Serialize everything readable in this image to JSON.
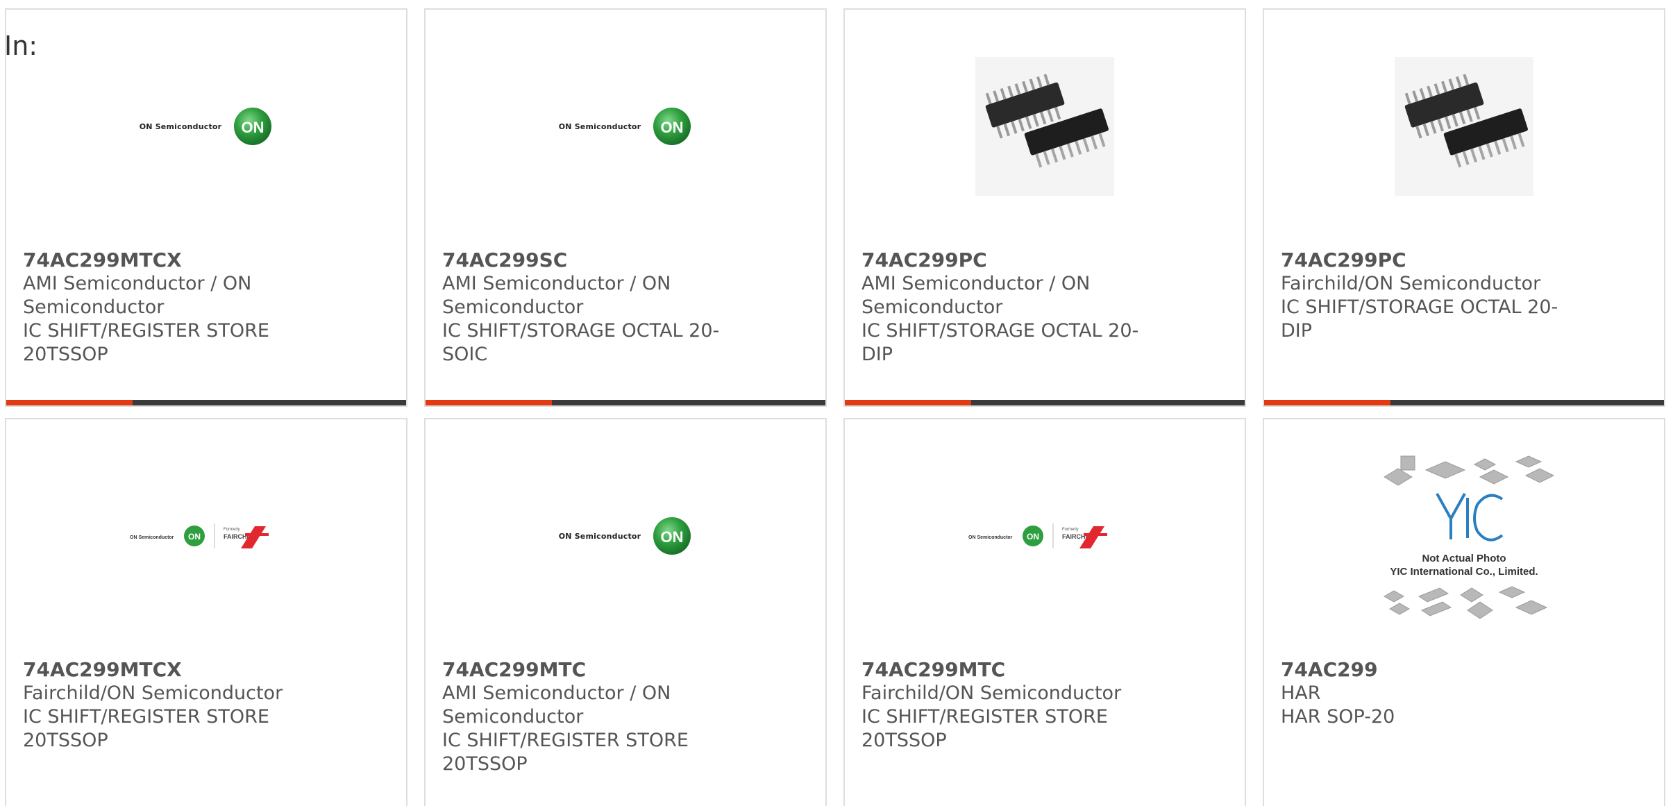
{
  "header": {
    "in_label": "In:"
  },
  "logo_text": {
    "on_semi": "ON Semiconductor",
    "on_badge": "ON",
    "formerly": "Formerly",
    "fairchild": "FAIRCHILD",
    "yic_not_actual": "Not Actual Photo",
    "yic_company": "YIC International Co., Limited."
  },
  "colors": {
    "accent": "#e23a12",
    "bar_dark": "#3a3a3a",
    "on_green": "#2e9e3e",
    "fairchild_red": "#e0282e",
    "yic_blue": "#2a7fc1"
  },
  "cards": [
    {
      "part": "74AC299MTCX",
      "manufacturer_line1": "AMI Semiconductor / ON",
      "manufacturer_line2": "Semiconductor",
      "desc_line1": "IC SHIFT/REGISTER STORE",
      "desc_line2": "20TSSOP",
      "image": "on-semiconductor-logo"
    },
    {
      "part": "74AC299SC",
      "manufacturer_line1": "AMI Semiconductor / ON",
      "manufacturer_line2": "Semiconductor",
      "desc_line1": "IC SHIFT/STORAGE OCTAL 20-",
      "desc_line2": "SOIC",
      "image": "on-semiconductor-logo"
    },
    {
      "part": "74AC299PC",
      "manufacturer_line1": "AMI Semiconductor / ON",
      "manufacturer_line2": "Semiconductor",
      "desc_line1": "IC SHIFT/STORAGE OCTAL 20-",
      "desc_line2": "DIP",
      "image": "dip-chip-photo"
    },
    {
      "part": "74AC299PC",
      "manufacturer_line1": "Fairchild/ON Semiconductor",
      "desc_line1": "IC SHIFT/STORAGE OCTAL 20-",
      "desc_line2": "DIP",
      "image": "dip-chip-photo"
    },
    {
      "part": "74AC299MTCX",
      "manufacturer_line1": "Fairchild/ON Semiconductor",
      "desc_line1": "IC SHIFT/REGISTER STORE",
      "desc_line2": "20TSSOP",
      "image": "on-fairchild-logo"
    },
    {
      "part": "74AC299MTC",
      "manufacturer_line1": "AMI Semiconductor / ON",
      "manufacturer_line2": "Semiconductor",
      "desc_line1": "IC SHIFT/REGISTER STORE",
      "desc_line2": "20TSSOP",
      "image": "on-semiconductor-logo"
    },
    {
      "part": "74AC299MTC",
      "manufacturer_line1": "Fairchild/ON Semiconductor",
      "desc_line1": "IC SHIFT/REGISTER STORE",
      "desc_line2": "20TSSOP",
      "image": "on-fairchild-logo"
    },
    {
      "part": "74AC299",
      "manufacturer_line1": "HAR",
      "desc_line1": "HAR SOP-20",
      "image": "yic-placeholder"
    }
  ]
}
